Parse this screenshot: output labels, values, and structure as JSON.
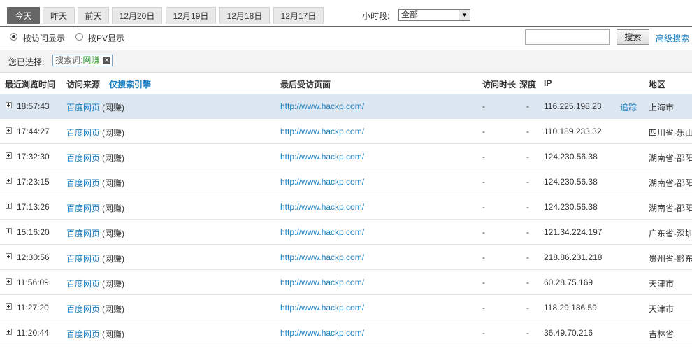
{
  "tabs": [
    "今天",
    "昨天",
    "前天",
    "12月20日",
    "12月19日",
    "12月18日",
    "12月17日"
  ],
  "period": {
    "label": "小时段:",
    "value": "全部"
  },
  "options": {
    "by_visit": "按访问显示",
    "by_pv": "按PV显示"
  },
  "search": {
    "button": "搜索",
    "advanced": "高级搜索",
    "value": ""
  },
  "filter": {
    "label": "您已选择:",
    "chip_prefix": "搜索词:",
    "chip_keyword": "网赚",
    "close": "✕"
  },
  "headers": {
    "time": "最近浏览时间",
    "source": "访问来源",
    "search_only": "仅搜索引擎",
    "last_page": "最后受访页面",
    "duration": "访问时长",
    "depth": "深度",
    "ip": "IP",
    "region": "地区"
  },
  "rows": [
    {
      "time": "18:57:43",
      "source": "百度网页",
      "keyword": "(网赚)",
      "page": "http://www.hackp.com/",
      "duration": "-",
      "depth": "-",
      "ip": "116.225.198.23",
      "track": "追踪",
      "region": "上海市"
    },
    {
      "time": "17:44:27",
      "source": "百度网页",
      "keyword": "(网赚)",
      "page": "http://www.hackp.com/",
      "duration": "-",
      "depth": "-",
      "ip": "110.189.233.32",
      "track": "",
      "region": "四川省-乐山"
    },
    {
      "time": "17:32:30",
      "source": "百度网页",
      "keyword": "(网赚)",
      "page": "http://www.hackp.com/",
      "duration": "-",
      "depth": "-",
      "ip": "124.230.56.38",
      "track": "",
      "region": "湖南省-邵阳"
    },
    {
      "time": "17:23:15",
      "source": "百度网页",
      "keyword": "(网赚)",
      "page": "http://www.hackp.com/",
      "duration": "-",
      "depth": "-",
      "ip": "124.230.56.38",
      "track": "",
      "region": "湖南省-邵阳"
    },
    {
      "time": "17:13:26",
      "source": "百度网页",
      "keyword": "(网赚)",
      "page": "http://www.hackp.com/",
      "duration": "-",
      "depth": "-",
      "ip": "124.230.56.38",
      "track": "",
      "region": "湖南省-邵阳"
    },
    {
      "time": "15:16:20",
      "source": "百度网页",
      "keyword": "(网赚)",
      "page": "http://www.hackp.com/",
      "duration": "-",
      "depth": "-",
      "ip": "121.34.224.197",
      "track": "",
      "region": "广东省-深圳"
    },
    {
      "time": "12:30:56",
      "source": "百度网页",
      "keyword": "(网赚)",
      "page": "http://www.hackp.com/",
      "duration": "-",
      "depth": "-",
      "ip": "218.86.231.218",
      "track": "",
      "region": "贵州省-黔东"
    },
    {
      "time": "11:56:09",
      "source": "百度网页",
      "keyword": "(网赚)",
      "page": "http://www.hackp.com/",
      "duration": "-",
      "depth": "-",
      "ip": "60.28.75.169",
      "track": "",
      "region": "天津市"
    },
    {
      "time": "11:27:20",
      "source": "百度网页",
      "keyword": "(网赚)",
      "page": "http://www.hackp.com/",
      "duration": "-",
      "depth": "-",
      "ip": "118.29.186.59",
      "track": "",
      "region": "天津市"
    },
    {
      "time": "11:20:44",
      "source": "百度网页",
      "keyword": "(网赚)",
      "page": "http://www.hackp.com/",
      "duration": "-",
      "depth": "-",
      "ip": "36.49.70.216",
      "track": "",
      "region": "吉林省"
    }
  ]
}
